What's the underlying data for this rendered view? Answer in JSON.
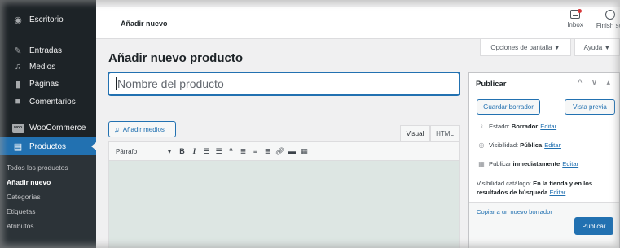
{
  "sidebar": {
    "items": [
      {
        "icon": "dashboard-icon",
        "label": "Escritorio"
      },
      {
        "icon": "pin-icon",
        "label": "Entradas"
      },
      {
        "icon": "media-icon",
        "label": "Medios"
      },
      {
        "icon": "pages-icon",
        "label": "Páginas"
      },
      {
        "icon": "comments-icon",
        "label": "Comentarios"
      },
      {
        "icon": "woocommerce-icon",
        "label": "WooCommerce",
        "icon_text": "woo"
      },
      {
        "icon": "products-icon",
        "label": "Productos"
      }
    ],
    "submenu": [
      "Todos los productos",
      "Añadir nuevo",
      "Categorías",
      "Etiquetas",
      "Atributos"
    ],
    "active_color": "#2271b1"
  },
  "topbar": {
    "title": "Añadir nuevo",
    "inbox_label": "Inbox",
    "finish_label": "Finish set"
  },
  "screen_options": {
    "screen_label": "Opciones de pantalla ▼",
    "help_label": "Ayuda ▼"
  },
  "main": {
    "page_title": "Añadir nuevo producto",
    "title_placeholder": "Nombre del producto",
    "add_media_label": "Añadir medios",
    "tabs": [
      "Visual",
      "HTML"
    ],
    "format_select": "Párrafo"
  },
  "publish_box": {
    "title": "Publicar",
    "save_draft": "Guardar borrador",
    "preview": "Vista previa",
    "status_label": "Estado:",
    "status_value": "Borrador",
    "visibility_label": "Visibilidad:",
    "visibility_value": "Pública",
    "publish_label": "Publicar",
    "publish_value": "inmediatamente",
    "edit_link": "Editar",
    "catalog_label": "Visibilidad catálogo:",
    "catalog_value": "En la tienda y en los resultados de búsqueda",
    "copy_link": "Copiar a un nuevo borrador",
    "publish_button": "Publicar"
  },
  "colors": {
    "sidebar_bg": "#1d2327",
    "accent": "#2271b1",
    "notification": "#d63638"
  }
}
